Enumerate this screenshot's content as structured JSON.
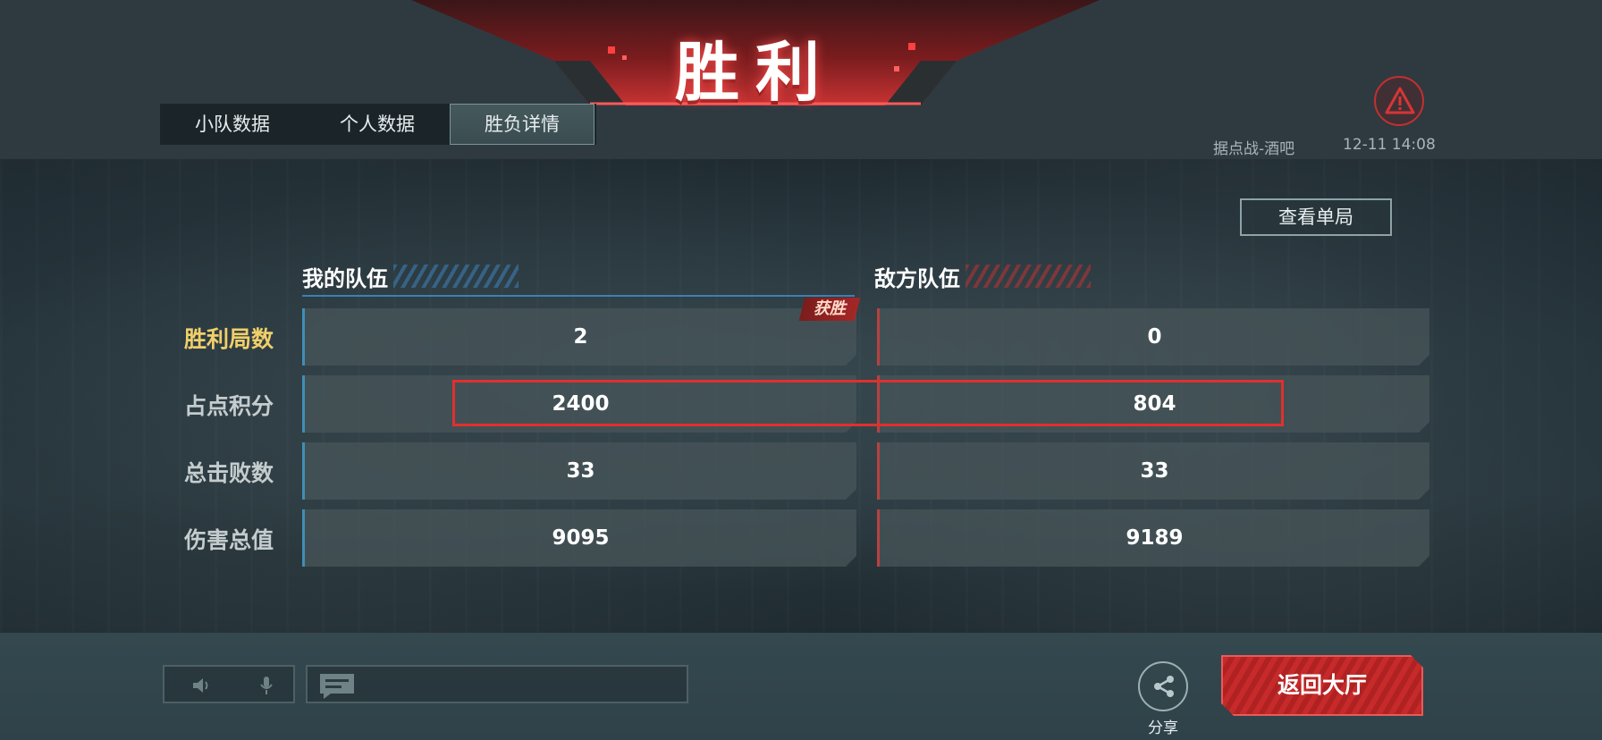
{
  "banner": {
    "title": "胜利"
  },
  "tabs": [
    {
      "label": "小队数据",
      "active": false
    },
    {
      "label": "个人数据",
      "active": false
    },
    {
      "label": "胜负详情",
      "active": true
    }
  ],
  "header": {
    "map_name": "据点战-酒吧",
    "match_time": "12-11 14:08"
  },
  "view_single_label": "查看单局",
  "teams": {
    "mine": "我的队伍",
    "enemy": "敌方队伍"
  },
  "victory_tag": "获胜",
  "stats": [
    {
      "label": "胜利局数",
      "mine": "2",
      "enemy": "0"
    },
    {
      "label": "占点积分",
      "mine": "2400",
      "enemy": "804"
    },
    {
      "label": "总击败数",
      "mine": "33",
      "enemy": "33"
    },
    {
      "label": "伤害总值",
      "mine": "9095",
      "enemy": "9189"
    }
  ],
  "footer": {
    "share_label": "分享",
    "return_label": "返回大厅"
  },
  "colors": {
    "accent_red": "#c62a2a",
    "mine_blue": "#3f8fb7",
    "victory_gold": "#f0cf6a"
  }
}
